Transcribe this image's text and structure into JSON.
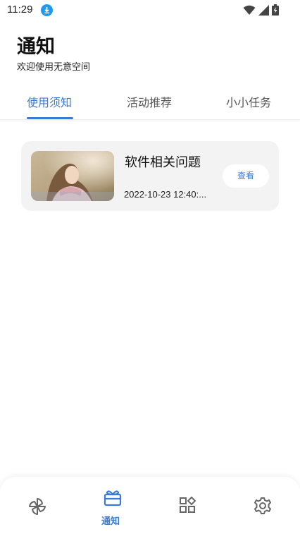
{
  "status_bar": {
    "time": "11:29",
    "icons": [
      "download-icon",
      "wifi-icon",
      "signal-icon",
      "battery-charging-icon"
    ]
  },
  "header": {
    "title": "通知",
    "subtitle": "欢迎使用无意空间"
  },
  "tabs": [
    {
      "label": "使用须知",
      "active": true
    },
    {
      "label": "活动推荐",
      "active": false
    },
    {
      "label": "小小任务",
      "active": false
    }
  ],
  "notices": [
    {
      "title": "软件相关问题",
      "date": "2022-10-23 12:40:...",
      "button_label": "查看",
      "thumbnail": "woman-portrait-image"
    }
  ],
  "bottom_nav": {
    "items": [
      {
        "icon": "pinwheel-icon",
        "label": "",
        "active": false
      },
      {
        "icon": "gift-box-icon",
        "label": "通知",
        "active": true
      },
      {
        "icon": "apps-grid-icon",
        "label": "",
        "active": false
      },
      {
        "icon": "gear-icon",
        "label": "",
        "active": false
      }
    ]
  },
  "colors": {
    "accent": "#3a7bd5",
    "card_bg": "#f3f3f3",
    "download_badge": "#1e9bf0"
  }
}
